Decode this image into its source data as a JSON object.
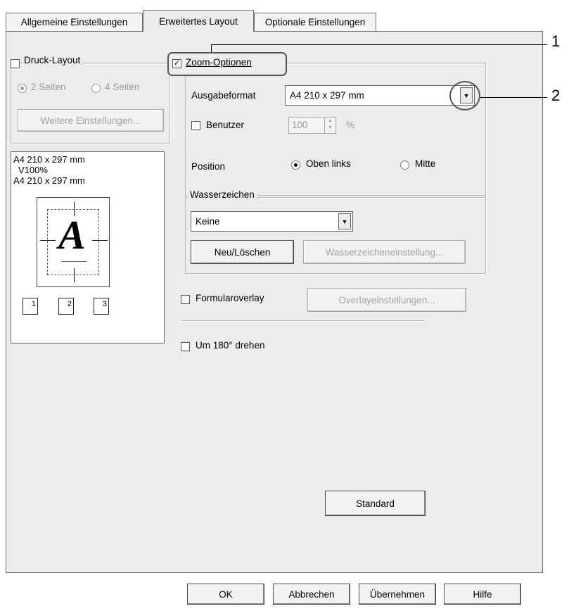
{
  "tabs": [
    {
      "label": "Allgemeine Einstellungen",
      "active": false
    },
    {
      "label": "Erweitertes Layout",
      "active": true
    },
    {
      "label": "Optionale Einstellungen",
      "active": false
    }
  ],
  "print_layout": {
    "checkbox_label": "Druck-Layout",
    "checked": false,
    "radio_2": "2 Seiten",
    "radio_4": "4 Seiten",
    "more_settings_button": "Weitere Einstellungen..."
  },
  "preview": {
    "line1": "A4 210 x 297 mm",
    "line2": "V100%",
    "line3": "A4 210 x 297 mm",
    "page_letter": "A",
    "copy_icons": [
      "1",
      "2",
      "3"
    ]
  },
  "zoom": {
    "checkbox_label": "Zoom-Optionen",
    "checked": true,
    "output_format_label": "Ausgabeformat",
    "output_format_value": "A4 210 x 297 mm",
    "user_label": "Benutzer",
    "user_checked": false,
    "user_value": "100",
    "user_unit": "%",
    "position_label": "Position",
    "position_top_left": "Oben links",
    "position_center": "Mitte"
  },
  "watermark": {
    "group_title": "Wasserzeichen",
    "value": "Keine",
    "new_delete_button": "Neu/Löschen",
    "settings_button": "Wasserzeicheneinstellung..."
  },
  "overlay": {
    "checkbox_label": "Formularoverlay",
    "checked": false,
    "settings_button": "Overlayeinstellungen..."
  },
  "rotate": {
    "checkbox_label": "Um 180° drehen",
    "checked": false
  },
  "standard_button": "Standard",
  "bottom_buttons": {
    "ok": "OK",
    "cancel": "Abbrechen",
    "apply": "Übernehmen",
    "help": "Hilfe"
  },
  "callouts": [
    "1",
    "2"
  ]
}
